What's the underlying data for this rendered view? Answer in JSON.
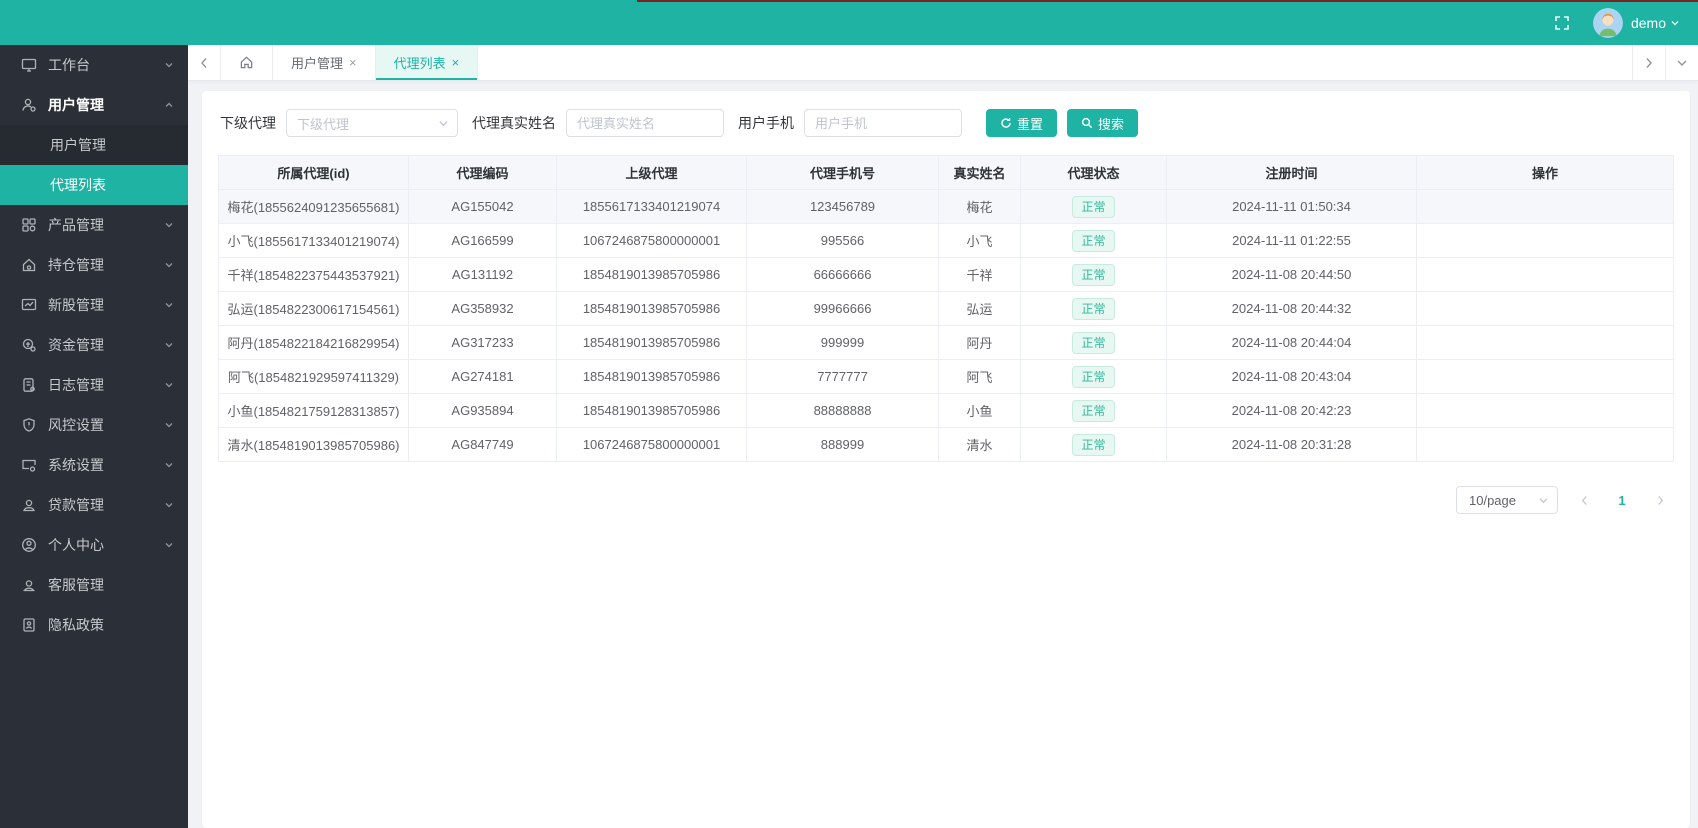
{
  "colors": {
    "accent": "#1fb3a3",
    "header_bg": "#1fb3a3",
    "sidebar_bg": "#2b3038",
    "status_text": "#33b89c",
    "status_bg": "#e7f8f2"
  },
  "header": {
    "username": "demo"
  },
  "sidebar": {
    "items": [
      {
        "label": "工作台"
      },
      {
        "label": "用户管理",
        "children": [
          {
            "label": "用户管理"
          },
          {
            "label": "代理列表",
            "active": true
          }
        ]
      },
      {
        "label": "产品管理"
      },
      {
        "label": "持仓管理"
      },
      {
        "label": "新股管理"
      },
      {
        "label": "资金管理"
      },
      {
        "label": "日志管理"
      },
      {
        "label": "风控设置"
      },
      {
        "label": "系统设置"
      },
      {
        "label": "贷款管理"
      },
      {
        "label": "个人中心"
      },
      {
        "label": "客服管理"
      },
      {
        "label": "隐私政策"
      }
    ]
  },
  "tabs": {
    "close_glyph": "×",
    "items": [
      {
        "label": "用户管理"
      },
      {
        "label": "代理列表",
        "active": true
      }
    ]
  },
  "filters": {
    "fields": [
      {
        "label": "下级代理",
        "placeholder": "下级代理",
        "type": "select",
        "value": ""
      },
      {
        "label": "代理真实姓名",
        "placeholder": "代理真实姓名",
        "type": "input",
        "value": ""
      },
      {
        "label": "用户手机",
        "placeholder": "用户手机",
        "type": "input",
        "value": ""
      }
    ],
    "reset_label": "重置",
    "search_label": "搜索"
  },
  "table": {
    "columns": [
      "所属代理(id)",
      "代理编码",
      "上级代理",
      "代理手机号",
      "真实姓名",
      "代理状态",
      "注册时间",
      "操作"
    ],
    "rows": [
      {
        "agent": "梅花(1855624091235655681)",
        "code": "AG155042",
        "parent": "1855617133401219074",
        "phone": "123456789",
        "name": "梅花",
        "status": "正常",
        "time": "2024-11-11 01:50:34"
      },
      {
        "agent": "小飞(1855617133401219074)",
        "code": "AG166599",
        "parent": "1067246875800000001",
        "phone": "995566",
        "name": "小飞",
        "status": "正常",
        "time": "2024-11-11 01:22:55"
      },
      {
        "agent": "千祥(1854822375443537921)",
        "code": "AG131192",
        "parent": "1854819013985705986",
        "phone": "66666666",
        "name": "千祥",
        "status": "正常",
        "time": "2024-11-08 20:44:50"
      },
      {
        "agent": "弘运(1854822300617154561)",
        "code": "AG358932",
        "parent": "1854819013985705986",
        "phone": "99966666",
        "name": "弘运",
        "status": "正常",
        "time": "2024-11-08 20:44:32"
      },
      {
        "agent": "阿丹(1854822184216829954)",
        "code": "AG317233",
        "parent": "1854819013985705986",
        "phone": "999999",
        "name": "阿丹",
        "status": "正常",
        "time": "2024-11-08 20:44:04"
      },
      {
        "agent": "阿飞(1854821929597411329)",
        "code": "AG274181",
        "parent": "1854819013985705986",
        "phone": "7777777",
        "name": "阿飞",
        "status": "正常",
        "time": "2024-11-08 20:43:04"
      },
      {
        "agent": "小鱼(1854821759128313857)",
        "code": "AG935894",
        "parent": "1854819013985705986",
        "phone": "88888888",
        "name": "小鱼",
        "status": "正常",
        "time": "2024-11-08 20:42:23"
      },
      {
        "agent": "清水(1854819013985705986)",
        "code": "AG847749",
        "parent": "1067246875800000001",
        "phone": "888999",
        "name": "清水",
        "status": "正常",
        "time": "2024-11-08 20:31:28"
      }
    ]
  },
  "pagination": {
    "page_size": "10/page",
    "current": "1"
  }
}
